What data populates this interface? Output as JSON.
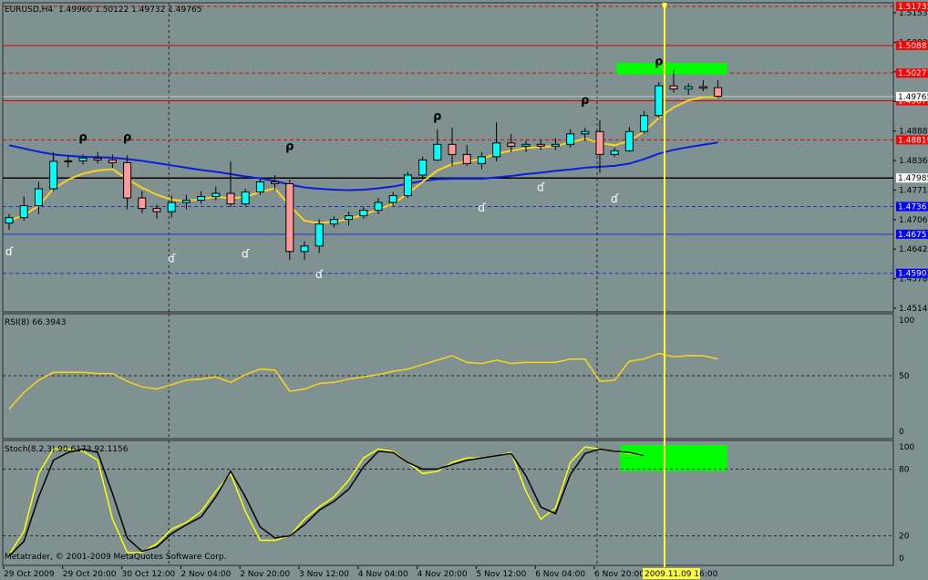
{
  "main": {
    "title": "EURUSD,H4",
    "ohlc": "1.49960 1.50122 1.49732 1.49765",
    "price_ticks": [
      "1.51530",
      "1.50880",
      "1.50200",
      "1.49540",
      "1.48880",
      "1.48360",
      "1.47710",
      "1.47060",
      "1.46420",
      "1.45780",
      "1.45140"
    ],
    "ylim": [
      1.4514,
      1.51735
    ],
    "h_lines": [
      {
        "price": 1.51735,
        "label": "1.51735",
        "color": "#e00000",
        "dashed": true,
        "tag": "red"
      },
      {
        "price": 1.50881,
        "label": "1.50881",
        "color": "#e00000",
        "dashed": false,
        "tag": "red"
      },
      {
        "price": 1.50277,
        "label": "1.50277",
        "color": "#e00000",
        "dashed": true,
        "tag": "red"
      },
      {
        "price": 1.49673,
        "label": "1.49673",
        "color": "#e00000",
        "dashed": false,
        "tag": "red"
      },
      {
        "price": 1.48819,
        "label": "1.48819",
        "color": "#e00000",
        "dashed": true,
        "tag": "red"
      },
      {
        "price": 1.47985,
        "label": "1.47985",
        "color": "#000000",
        "dashed": false,
        "tag": "black"
      },
      {
        "price": 1.47361,
        "label": "1.47361",
        "color": "#2030d0",
        "dashed": true,
        "tag": "blue"
      },
      {
        "price": 1.46757,
        "label": "1.46757",
        "color": "#2030d0",
        "dashed": false,
        "tag": "blue"
      },
      {
        "price": 1.45903,
        "label": "1.45903",
        "color": "#2030d0",
        "dashed": true,
        "tag": "blue"
      }
    ],
    "current_price_label": "1.49765",
    "candles": [
      [
        1.47,
        1.472,
        1.4685,
        1.4712
      ],
      [
        1.4712,
        1.4758,
        1.4705,
        1.4738
      ],
      [
        1.4738,
        1.479,
        1.472,
        1.4775
      ],
      [
        1.4775,
        1.4855,
        1.477,
        1.4835
      ],
      [
        1.4835,
        1.4848,
        1.4822,
        1.4836
      ],
      [
        1.4836,
        1.485,
        1.4828,
        1.4842
      ],
      [
        1.4842,
        1.4855,
        1.483,
        1.4838
      ],
      [
        1.4838,
        1.485,
        1.482,
        1.4832
      ],
      [
        1.4832,
        1.4848,
        1.473,
        1.4755
      ],
      [
        1.4755,
        1.477,
        1.4722,
        1.4732
      ],
      [
        1.4732,
        1.474,
        1.471,
        1.4725
      ],
      [
        1.4725,
        1.476,
        1.4712,
        1.4745
      ],
      [
        1.4745,
        1.4762,
        1.473,
        1.475
      ],
      [
        1.475,
        1.477,
        1.4742,
        1.4758
      ],
      [
        1.4758,
        1.478,
        1.475,
        1.4765
      ],
      [
        1.4765,
        1.4835,
        1.4735,
        1.4742
      ],
      [
        1.4742,
        1.4775,
        1.4738,
        1.4768
      ],
      [
        1.4768,
        1.4798,
        1.4762,
        1.479
      ],
      [
        1.479,
        1.4805,
        1.4772,
        1.4786
      ],
      [
        1.4786,
        1.4795,
        1.462,
        1.4638
      ],
      [
        1.4638,
        1.466,
        1.462,
        1.465
      ],
      [
        1.465,
        1.4708,
        1.4635,
        1.4698
      ],
      [
        1.4698,
        1.4715,
        1.469,
        1.4708
      ],
      [
        1.4708,
        1.4725,
        1.4695,
        1.4716
      ],
      [
        1.4716,
        1.4735,
        1.471,
        1.4728
      ],
      [
        1.4728,
        1.4755,
        1.472,
        1.4745
      ],
      [
        1.4745,
        1.4768,
        1.4738,
        1.476
      ],
      [
        1.476,
        1.4812,
        1.4755,
        1.4805
      ],
      [
        1.4805,
        1.4845,
        1.48,
        1.4838
      ],
      [
        1.4838,
        1.4905,
        1.4835,
        1.4872
      ],
      [
        1.4872,
        1.4908,
        1.4825,
        1.485
      ],
      [
        1.485,
        1.487,
        1.4825,
        1.483
      ],
      [
        1.483,
        1.4855,
        1.4818,
        1.4845
      ],
      [
        1.4845,
        1.492,
        1.4835,
        1.4875
      ],
      [
        1.4875,
        1.4895,
        1.4855,
        1.4868
      ],
      [
        1.4868,
        1.488,
        1.4855,
        1.4872
      ],
      [
        1.4872,
        1.4882,
        1.486,
        1.4868
      ],
      [
        1.4868,
        1.4885,
        1.486,
        1.4872
      ],
      [
        1.4872,
        1.4905,
        1.4865,
        1.4895
      ],
      [
        1.4895,
        1.4908,
        1.488,
        1.49
      ],
      [
        1.49,
        1.4925,
        1.481,
        1.485
      ],
      [
        1.485,
        1.4865,
        1.4845,
        1.4858
      ],
      [
        1.4858,
        1.491,
        1.4855,
        1.49
      ],
      [
        1.49,
        1.4945,
        1.4895,
        1.4935
      ],
      [
        1.4935,
        1.5008,
        1.493,
        1.5
      ],
      [
        1.5,
        1.5035,
        1.4985,
        1.4993
      ],
      [
        1.4993,
        1.5005,
        1.498,
        1.4998
      ],
      [
        1.4998,
        1.5012,
        1.4988,
        1.4995
      ],
      [
        1.4996,
        1.5012,
        1.4973,
        1.4977
      ]
    ],
    "ma_fast": [
      1.4706,
      1.4717,
      1.4738,
      1.4775,
      1.4795,
      1.4808,
      1.4815,
      1.4818,
      1.4796,
      1.4777,
      1.4762,
      1.4751,
      1.4749,
      1.4752,
      1.4758,
      1.4754,
      1.4757,
      1.4768,
      1.4776,
      1.4738,
      1.4705,
      1.47,
      1.4703,
      1.4709,
      1.4718,
      1.473,
      1.4742,
      1.4765,
      1.479,
      1.4815,
      1.4829,
      1.4835,
      1.484,
      1.4852,
      1.4858,
      1.4864,
      1.4866,
      1.4868,
      1.4876,
      1.4885,
      1.4875,
      1.487,
      1.488,
      1.49,
      1.493,
      1.4953,
      1.4968,
      1.4975,
      1.4975
    ],
    "ma_slow_start": 1.487,
    "ma_slow": [
      1.487,
      1.4863,
      1.4856,
      1.485,
      1.4847,
      1.4845,
      1.4844,
      1.4843,
      1.484,
      1.4836,
      1.4831,
      1.4826,
      1.4821,
      1.4816,
      1.4812,
      1.4807,
      1.4802,
      1.4798,
      1.4792,
      1.4784,
      1.4778,
      1.4775,
      1.4773,
      1.4772,
      1.4773,
      1.4776,
      1.478,
      1.4786,
      1.4792,
      1.4796,
      1.4797,
      1.4797,
      1.4797,
      1.48,
      1.4803,
      1.4807,
      1.481,
      1.4814,
      1.4817,
      1.4821,
      1.4823,
      1.4825,
      1.483,
      1.484,
      1.4852,
      1.486,
      1.4866,
      1.4871,
      1.4876
    ],
    "fractals_up": [
      [
        5,
        1.488
      ],
      [
        8,
        1.488
      ],
      [
        19,
        1.486
      ],
      [
        29,
        1.4925
      ],
      [
        39,
        1.496
      ],
      [
        44,
        1.5045
      ]
    ],
    "fractals_down": [
      [
        0,
        1.463
      ],
      [
        11,
        1.4615
      ],
      [
        16,
        1.4625
      ],
      [
        21,
        1.458
      ],
      [
        32,
        1.4725
      ],
      [
        36,
        1.477
      ],
      [
        41,
        1.4745
      ]
    ],
    "resistance_zone": [
      1.5025,
      1.505
    ],
    "zone_candle_range": [
      42,
      48
    ]
  },
  "rsi": {
    "title": "RSI(8) 66.3943",
    "ticks": [
      "100",
      "50",
      "0"
    ],
    "ylim": [
      0,
      100
    ],
    "level": 50,
    "values": [
      20,
      35,
      46,
      53,
      53,
      53,
      52,
      52,
      45,
      40,
      38,
      42,
      46,
      47,
      49,
      44,
      51,
      56,
      55,
      36,
      38,
      43,
      44,
      47,
      49,
      51,
      54,
      56,
      60,
      64,
      68,
      62,
      61,
      64,
      61,
      62,
      62,
      62,
      65,
      65,
      45,
      46,
      63,
      65,
      70,
      67,
      68,
      68,
      65
    ]
  },
  "stoch": {
    "title": "Stoch(8,2,3) 90.6173 92.1156",
    "ticks": [
      "100",
      "80",
      "20",
      "0"
    ],
    "ylim": [
      0,
      100
    ],
    "levels": [
      80,
      20
    ],
    "main": [
      3,
      24,
      76,
      98,
      98,
      96,
      88,
      35,
      5,
      5,
      13,
      26,
      32,
      42,
      60,
      76,
      42,
      16,
      16,
      20,
      35,
      46,
      55,
      70,
      90,
      98,
      96,
      86,
      76,
      78,
      86,
      90,
      90,
      92,
      95,
      60,
      35,
      45,
      86,
      100,
      98,
      96,
      94,
      92
    ],
    "signal": [
      2,
      15,
      55,
      88,
      95,
      98,
      95,
      58,
      18,
      6,
      10,
      22,
      30,
      37,
      55,
      78,
      55,
      28,
      18,
      20,
      30,
      43,
      51,
      62,
      82,
      96,
      95,
      86,
      80,
      80,
      84,
      88,
      90,
      92,
      94,
      74,
      46,
      40,
      75,
      94,
      98,
      96,
      95,
      92
    ],
    "zone": [
      78,
      100
    ]
  },
  "time_axis": {
    "labels": [
      {
        "text": "29 Oct 2009",
        "i": 0
      },
      {
        "text": "29 Oct 20:00",
        "i": 4
      },
      {
        "text": "30 Oct 12:00",
        "i": 8
      },
      {
        "text": "2 Nov 04:00",
        "i": 12
      },
      {
        "text": "2 Nov 20:00",
        "i": 16
      },
      {
        "text": "3 Nov 12:00",
        "i": 20
      },
      {
        "text": "4 Nov 04:00",
        "i": 24
      },
      {
        "text": "4 Nov 20:00",
        "i": 28
      },
      {
        "text": "5 Nov 12:00",
        "i": 32
      },
      {
        "text": "6 Nov 04:00",
        "i": 36
      },
      {
        "text": "6 Nov 20:00",
        "i": 40
      }
    ],
    "cursor_label": "2009.11.09 16:00",
    "cursor_index": 45
  },
  "copyright": "Metatrader, © 2001-2009 MetaQuotes Software Corp.",
  "colors": {
    "background": "#7f9191",
    "bull": "#00ffff",
    "bear": "#ff9a9a",
    "ma_fast": "#ffd21a",
    "ma_slow": "#0a1edc",
    "rsi_line": "#ffd21a",
    "stoch_main": "#ffff00",
    "stoch_signal": "#000000",
    "zone": "#00ff00",
    "cursor": "#ffff40"
  },
  "chart_data": {
    "type": "candlestick",
    "title": "EURUSD,H4",
    "ylim": [
      1.4514,
      1.51735
    ],
    "series": [
      {
        "name": "RSI(8) 66.3943"
      },
      {
        "name": "Stoch(8,2,3) 90.6173 92.1156"
      }
    ]
  }
}
